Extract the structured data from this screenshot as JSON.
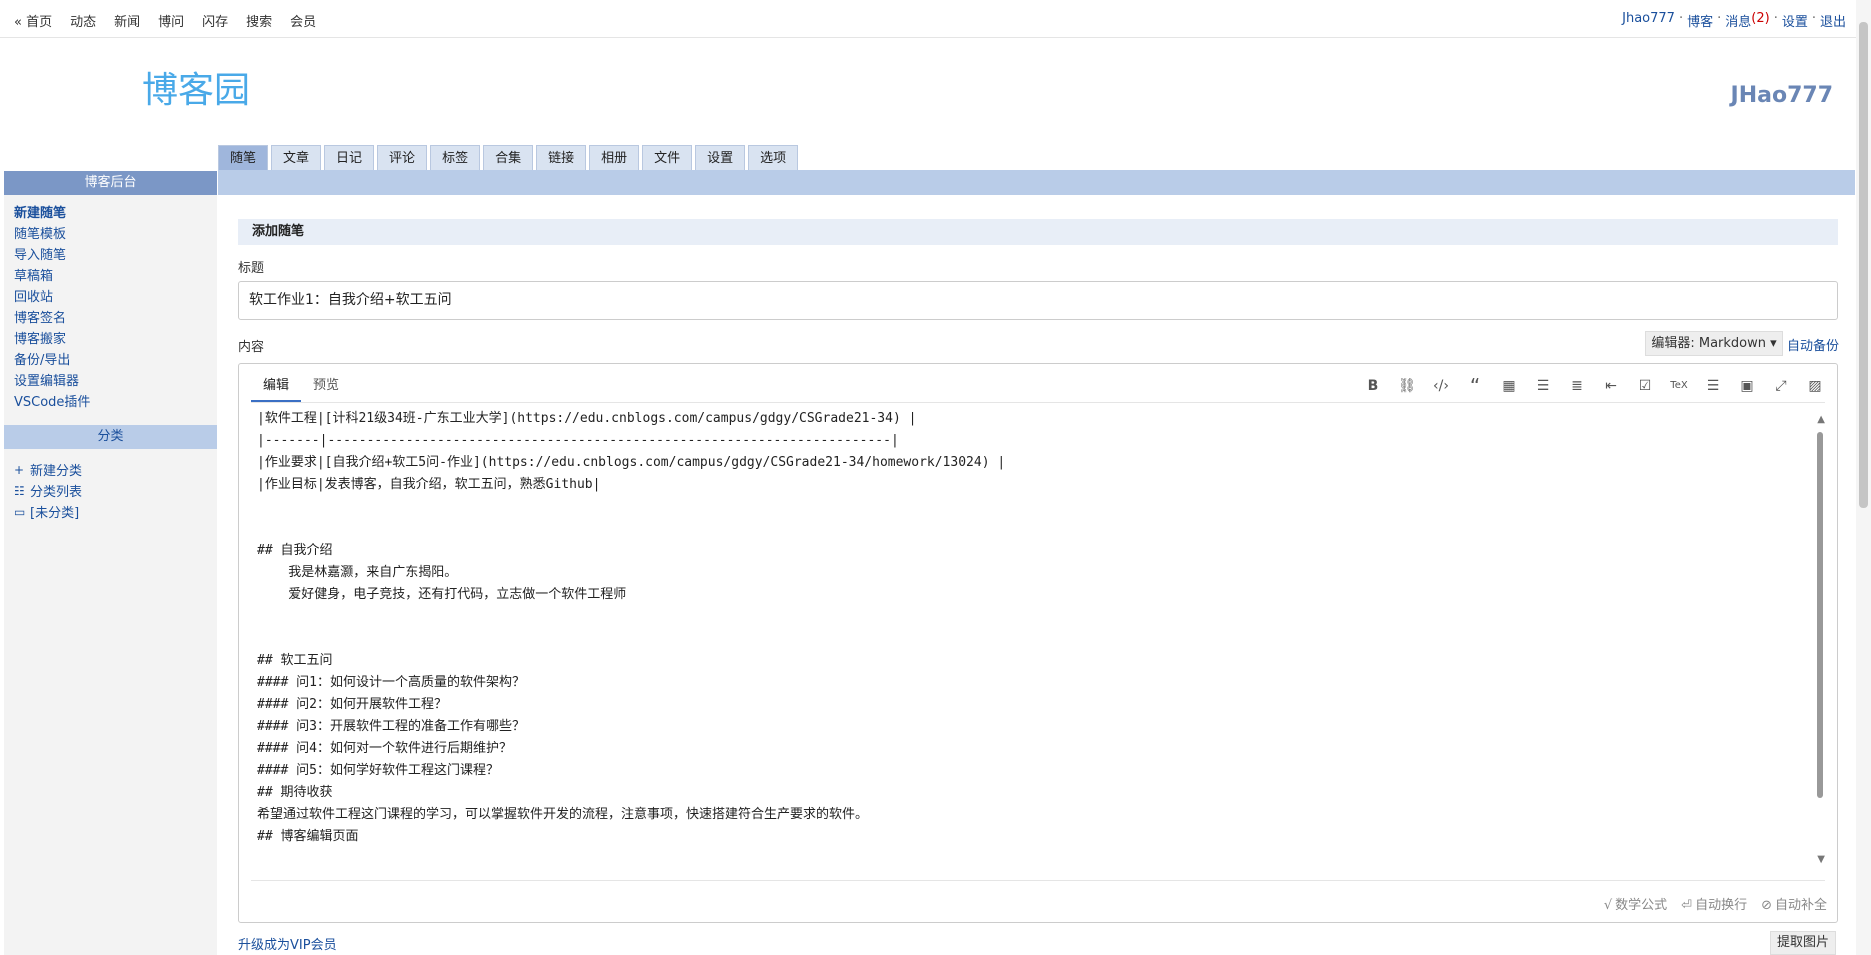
{
  "topnav": {
    "left": [
      "« 首页",
      "动态",
      "新闻",
      "博问",
      "闪存",
      "搜索",
      "会员"
    ],
    "user": "Jhao777",
    "blog": "博客",
    "messages": "消息",
    "messages_count": "(2)",
    "settings": "设置",
    "logout": "退出"
  },
  "header": {
    "logo_text": "博客园",
    "blog_name": "JHao777"
  },
  "tabs": [
    "随笔",
    "文章",
    "日记",
    "评论",
    "标签",
    "合集",
    "链接",
    "相册",
    "文件",
    "设置",
    "选项"
  ],
  "sidebar": {
    "title": "博客后台",
    "items": [
      "新建随笔",
      "随笔模板",
      "导入随笔",
      "草稿箱",
      "回收站",
      "博客签名",
      "博客搬家",
      "备份/导出",
      "设置编辑器",
      "VSCode插件"
    ],
    "category_title": "分类",
    "categories": [
      "新建分类",
      "分类列表",
      "[未分类]"
    ]
  },
  "main": {
    "section_title": "添加随笔",
    "title_label": "标题",
    "title_value": "软工作业1：自我介绍+软工五问",
    "content_label": "内容",
    "editor_select": "编辑器: Markdown ▾",
    "autosave": "自动备份",
    "editor_tabs": [
      "编辑",
      "预览"
    ],
    "toolbar_icons": [
      "bold-icon",
      "link-icon",
      "code-icon",
      "quote-icon",
      "table-icon",
      "bullet-list-icon",
      "ordered-list-icon",
      "indent-icon",
      "checkbox-icon",
      "tex-icon",
      "toc-icon",
      "save-icon",
      "fullscreen-icon",
      "image-icon"
    ],
    "code_lines": [
      "|软件工程|[计科21级34班-广东工业大学](https://edu.cnblogs.com/campus/gdgy/CSGrade21-34) |",
      "|-------|------------------------------------------------------------------------|",
      "|作业要求|[自我介绍+软工5问-作业](https://edu.cnblogs.com/campus/gdgy/CSGrade21-34/homework/13024) |",
      "|作业目标|发表博客，自我介绍，软工五问，熟悉Github|",
      "",
      "",
      "## 自我介绍",
      "    我是林嘉灏，来自广东揭阳。",
      "    爱好健身，电子竞技，还有打代码，立志做一个软件工程师",
      "",
      "",
      "## 软工五问",
      "#### 问1：如何设计一个高质量的软件架构？",
      "#### 问2：如何开展软件工程？",
      "#### 问3：开展软件工程的准备工作有哪些？",
      "#### 问4：如何对一个软件进行后期维护？",
      "#### 问5：如何学好软件工程这门课程？",
      "## 期待收获",
      "希望通过软件工程这门课程的学习，可以掌握软件开发的流程，注意事项，快速搭建符合生产要求的软件。",
      "## 博客编辑页面"
    ],
    "footer": [
      "数学公式",
      "自动换行",
      "自动补全"
    ],
    "vip_link": "升级成为VIP会员",
    "fetch_button": "提取图片"
  }
}
